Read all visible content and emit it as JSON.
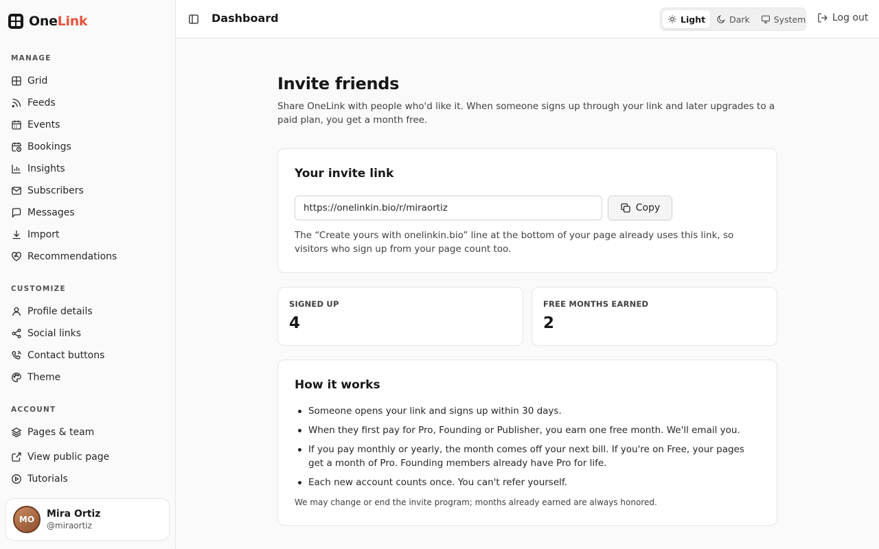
{
  "brand": {
    "name_part1": "One",
    "name_part2": "Link"
  },
  "sidebar": {
    "sections": [
      {
        "title": "MANAGE"
      },
      {
        "title": "CUSTOMIZE"
      },
      {
        "title": "ACCOUNT"
      }
    ],
    "manage": [
      "Grid",
      "Feeds",
      "Events",
      "Bookings",
      "Insights",
      "Subscribers",
      "Messages",
      "Import",
      "Recommendations"
    ],
    "customize": [
      "Profile details",
      "Social links",
      "Contact buttons",
      "Theme"
    ],
    "account": [
      "Pages & team",
      "View public page",
      "Tutorials"
    ]
  },
  "user": {
    "initials": "MO",
    "name": "Mira Ortiz",
    "handle": "@miraortiz"
  },
  "header": {
    "title": "Dashboard",
    "theme": {
      "light": "Light",
      "dark": "Dark",
      "system": "System",
      "selected": "Light"
    },
    "logout": "Log out"
  },
  "page": {
    "title": "Invite friends",
    "intro": "Share OneLink with people who'd like it. When someone signs up through your link and later upgrades to a paid plan, you get a month free."
  },
  "invite_card": {
    "title": "Your invite link",
    "link_value": "https://onelinkin.bio/r/miraortiz",
    "copy_label": "Copy",
    "note": "The “Create yours with onelinkin.bio” line at the bottom of your page already uses this link, so visitors who sign up from your page count too."
  },
  "stats": [
    {
      "label": "SIGNED UP",
      "value": "4"
    },
    {
      "label": "FREE MONTHS EARNED",
      "value": "2"
    }
  ],
  "how_it_works": {
    "title": "How it works",
    "items": [
      "Someone opens your link and signs up within 30 days.",
      "When they first pay for Pro, Founding or Publisher, you earn one free month. We'll email you.",
      "If you pay monthly or yearly, the month comes off your next bill. If you're on Free, your pages get a month of Pro. Founding members already have Pro for life.",
      "Each new account counts once. You can't refer yourself."
    ],
    "fine_print": "We may change or end the invite program; months already earned are always honored."
  },
  "colors": {
    "brand_accent": "#e5533d",
    "text": "#171717",
    "border": "#e5e5e5"
  }
}
